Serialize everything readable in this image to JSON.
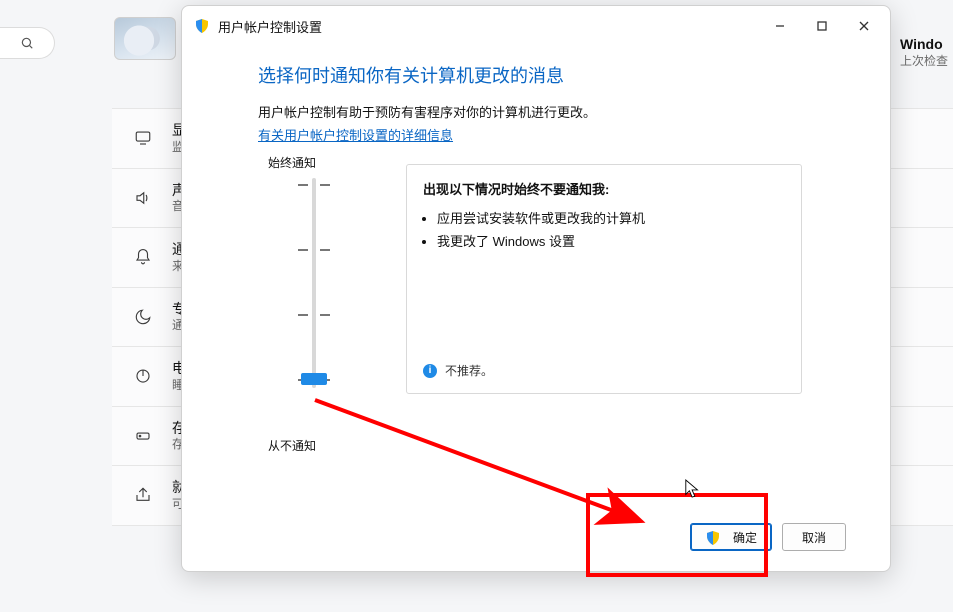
{
  "background": {
    "right_header": {
      "title": "Windo",
      "subtitle": "上次检查"
    },
    "rows": [
      {
        "icon": "monitor",
        "title": "显",
        "subtitle": "监"
      },
      {
        "icon": "speaker",
        "title": "声",
        "subtitle": "音"
      },
      {
        "icon": "bell",
        "title": "通",
        "subtitle": "来"
      },
      {
        "icon": "moon",
        "title": "专",
        "subtitle": "通"
      },
      {
        "icon": "power",
        "title": "电",
        "subtitle": "睡"
      },
      {
        "icon": "storage",
        "title": "存",
        "subtitle": "存"
      },
      {
        "icon": "share",
        "title": "就近共享",
        "subtitle": "可发现性、接收的文件位置"
      }
    ]
  },
  "window": {
    "title": "用户帐户控制设置",
    "heading": "选择何时通知你有关计算机更改的消息",
    "desc": "用户帐户控制有助于预防有害程序对你的计算机进行更改。",
    "link": "有关用户帐户控制设置的详细信息",
    "slider": {
      "top_label": "始终通知",
      "bottom_label": "从不通知",
      "panel_title": "出现以下情况时始终不要通知我:",
      "items": [
        "应用尝试安装软件或更改我的计算机",
        "我更改了 Windows 设置"
      ],
      "note": "不推荐。"
    },
    "buttons": {
      "ok": "确定",
      "cancel": "取消"
    }
  }
}
